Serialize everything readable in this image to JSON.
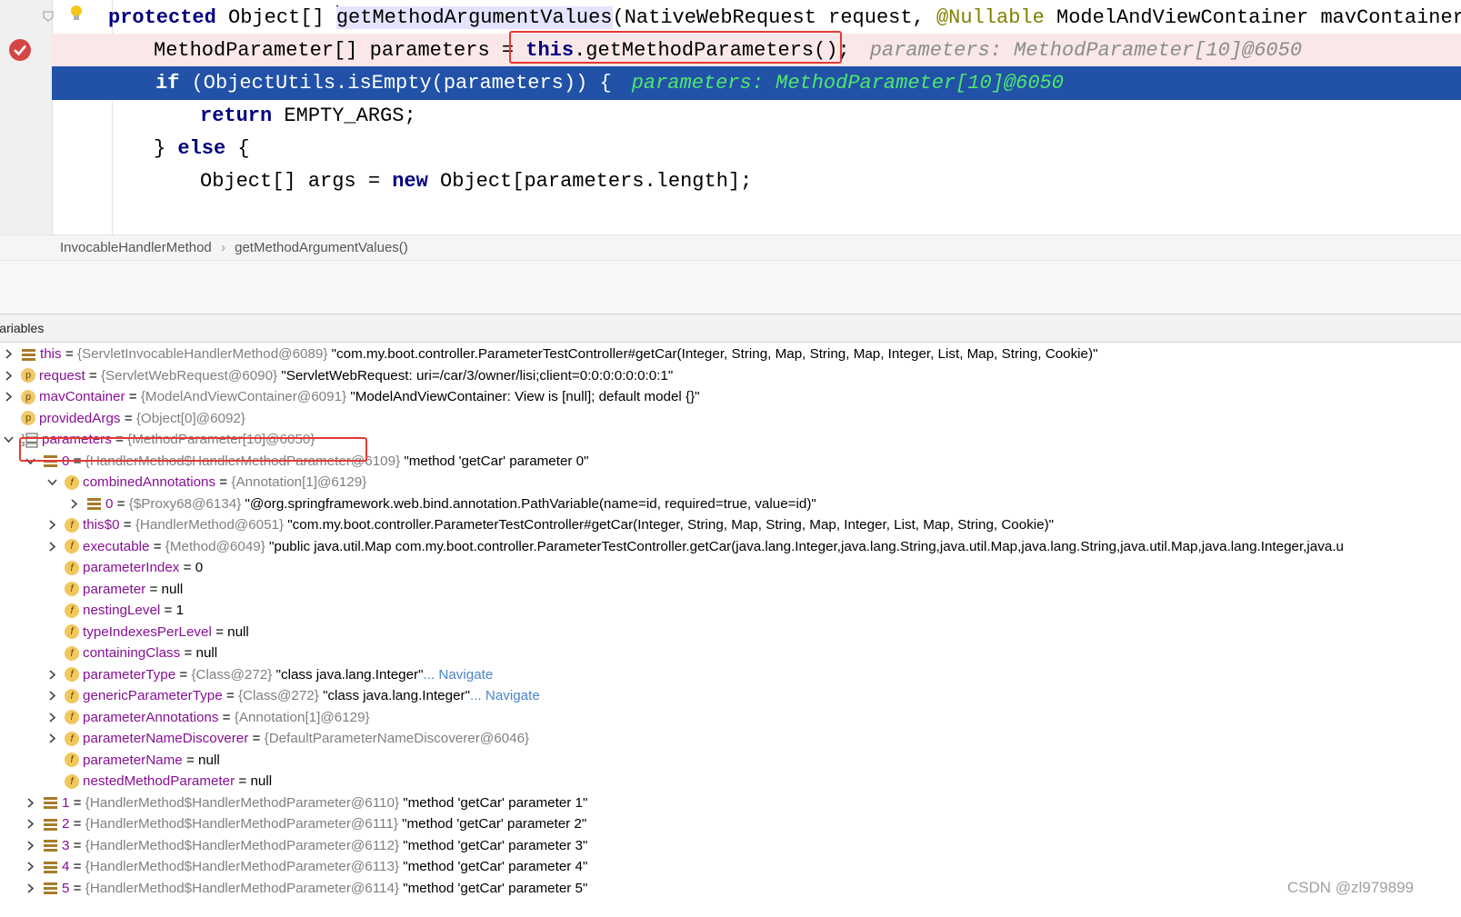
{
  "code": {
    "line1": {
      "kw1": "protected",
      "t1": " Object[] ",
      "method": "getMethodArgumentValues",
      "t2": "(NativeWebRequest request, ",
      "ann": "@Nullable",
      "t3": " ModelAndViewContainer mavContainer,"
    },
    "line2": {
      "t1": "MethodParameter[] parameters = ",
      "kw": "this",
      "t2": ".getMethodParameters();",
      "hint": "parameters: MethodParameter[10]@6050"
    },
    "line3": {
      "kw": "if",
      "t1": " (ObjectUtils.isEmpty(parameters)) {",
      "hint": "parameters: MethodParameter[10]@6050"
    },
    "line4": {
      "kw": "return",
      "t1": " EMPTY_ARGS;"
    },
    "line5": {
      "t0": "} ",
      "kw": "else",
      "t1": " {"
    },
    "line6": {
      "t1": "Object[] args = ",
      "kw": "new",
      "t2": " Object[parameters.length];"
    }
  },
  "breadcrumb": {
    "class": "InvocableHandlerMethod",
    "sep": "›",
    "method": "getMethodArgumentValues()"
  },
  "panel": {
    "title": "Variables"
  },
  "tree": [
    {
      "name": "this",
      "eq": " = ",
      "type": "{ServletInvocableHandlerMethod@6089}",
      "value": " \"com.my.boot.controller.ParameterTestController#getCar(Integer, String, Map, String, Map, Integer, List, Map, String, Cookie)\"",
      "link": ""
    },
    {
      "name": "request",
      "eq": " = ",
      "type": "{ServletWebRequest@6090}",
      "value": " \"ServletWebRequest: uri=/car/3/owner/lisi;client=0:0:0:0:0:0:0:1\"",
      "link": ""
    },
    {
      "name": "mavContainer",
      "eq": " = ",
      "type": "{ModelAndViewContainer@6091}",
      "value": " \"ModelAndViewContainer: View is [null]; default model {}\"",
      "link": ""
    },
    {
      "name": "providedArgs",
      "eq": " = ",
      "type": "{Object[0]@6092}",
      "value": "",
      "link": ""
    },
    {
      "name": "parameters",
      "eq": " = ",
      "type": "{MethodParameter[10]@6050}",
      "value": "",
      "link": ""
    },
    {
      "name": "0",
      "eq": " = ",
      "type": "{HandlerMethod$HandlerMethodParameter@6109}",
      "value": " \"method 'getCar' parameter 0\"",
      "link": ""
    },
    {
      "name": "combinedAnnotations",
      "eq": " = ",
      "type": "{Annotation[1]@6129}",
      "value": "",
      "link": ""
    },
    {
      "name": "0",
      "eq": " = ",
      "type": "{$Proxy68@6134}",
      "value": " \"@org.springframework.web.bind.annotation.PathVariable(name=id, required=true, value=id)\"",
      "link": ""
    },
    {
      "name": "this$0",
      "eq": " = ",
      "type": "{HandlerMethod@6051}",
      "value": " \"com.my.boot.controller.ParameterTestController#getCar(Integer, String, Map, String, Map, Integer, List, Map, String, Cookie)\"",
      "link": ""
    },
    {
      "name": "executable",
      "eq": " = ",
      "type": "{Method@6049}",
      "value": " \"public java.util.Map com.my.boot.controller.ParameterTestController.getCar(java.lang.Integer,java.lang.String,java.util.Map,java.lang.String,java.util.Map,java.lang.Integer,java.u",
      "link": ""
    },
    {
      "name": "parameterIndex",
      "eq": " = ",
      "type": "",
      "value": "0",
      "link": ""
    },
    {
      "name": "parameter",
      "eq": " = ",
      "type": "",
      "value": "null",
      "link": ""
    },
    {
      "name": "nestingLevel",
      "eq": " = ",
      "type": "",
      "value": "1",
      "link": ""
    },
    {
      "name": "typeIndexesPerLevel",
      "eq": " = ",
      "type": "",
      "value": "null",
      "link": ""
    },
    {
      "name": "containingClass",
      "eq": " = ",
      "type": "",
      "value": "null",
      "link": ""
    },
    {
      "name": "parameterType",
      "eq": " = ",
      "type": "{Class@272}",
      "value": " \"class java.lang.Integer\"",
      "link": "... Navigate"
    },
    {
      "name": "genericParameterType",
      "eq": " = ",
      "type": "{Class@272}",
      "value": " \"class java.lang.Integer\"",
      "link": "... Navigate"
    },
    {
      "name": "parameterAnnotations",
      "eq": " = ",
      "type": "{Annotation[1]@6129}",
      "value": "",
      "link": ""
    },
    {
      "name": "parameterNameDiscoverer",
      "eq": " = ",
      "type": "{DefaultParameterNameDiscoverer@6046}",
      "value": "",
      "link": ""
    },
    {
      "name": "parameterName",
      "eq": " = ",
      "type": "",
      "value": "null",
      "link": ""
    },
    {
      "name": "nestedMethodParameter",
      "eq": " = ",
      "type": "",
      "value": "null",
      "link": ""
    },
    {
      "name": "1",
      "eq": " = ",
      "type": "{HandlerMethod$HandlerMethodParameter@6110}",
      "value": " \"method 'getCar' parameter 1\"",
      "link": ""
    },
    {
      "name": "2",
      "eq": " = ",
      "type": "{HandlerMethod$HandlerMethodParameter@6111}",
      "value": " \"method 'getCar' parameter 2\"",
      "link": ""
    },
    {
      "name": "3",
      "eq": " = ",
      "type": "{HandlerMethod$HandlerMethodParameter@6112}",
      "value": " \"method 'getCar' parameter 3\"",
      "link": ""
    },
    {
      "name": "4",
      "eq": " = ",
      "type": "{HandlerMethod$HandlerMethodParameter@6113}",
      "value": " \"method 'getCar' parameter 4\"",
      "link": ""
    },
    {
      "name": "5",
      "eq": " = ",
      "type": "{HandlerMethod$HandlerMethodParameter@6114}",
      "value": " \"method 'getCar' parameter 5\"",
      "link": ""
    }
  ],
  "watermark": "CSDN @zl979899",
  "colors": {
    "selection": "#2152a8",
    "breakpointLine": "#fae8e8",
    "highlightBox": "#e53935",
    "keyword": "#000080",
    "varName": "#871094"
  }
}
